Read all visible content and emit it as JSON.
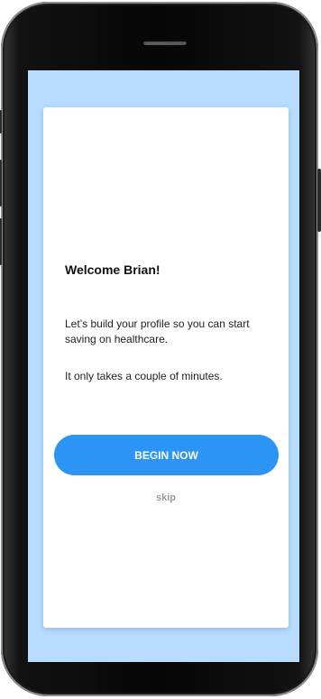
{
  "onboarding": {
    "welcome_title": "Welcome Brian!",
    "intro_text": "Let’s build your profile so you can start saving on healthcare.",
    "duration_text": "It only takes a couple of minutes.",
    "begin_label": "BEGIN NOW",
    "skip_label": "skip"
  },
  "colors": {
    "screen_background": "#b8dcff",
    "primary_button": "#2b94f5",
    "card_background": "#ffffff",
    "skip_text": "#9a9a9a"
  }
}
